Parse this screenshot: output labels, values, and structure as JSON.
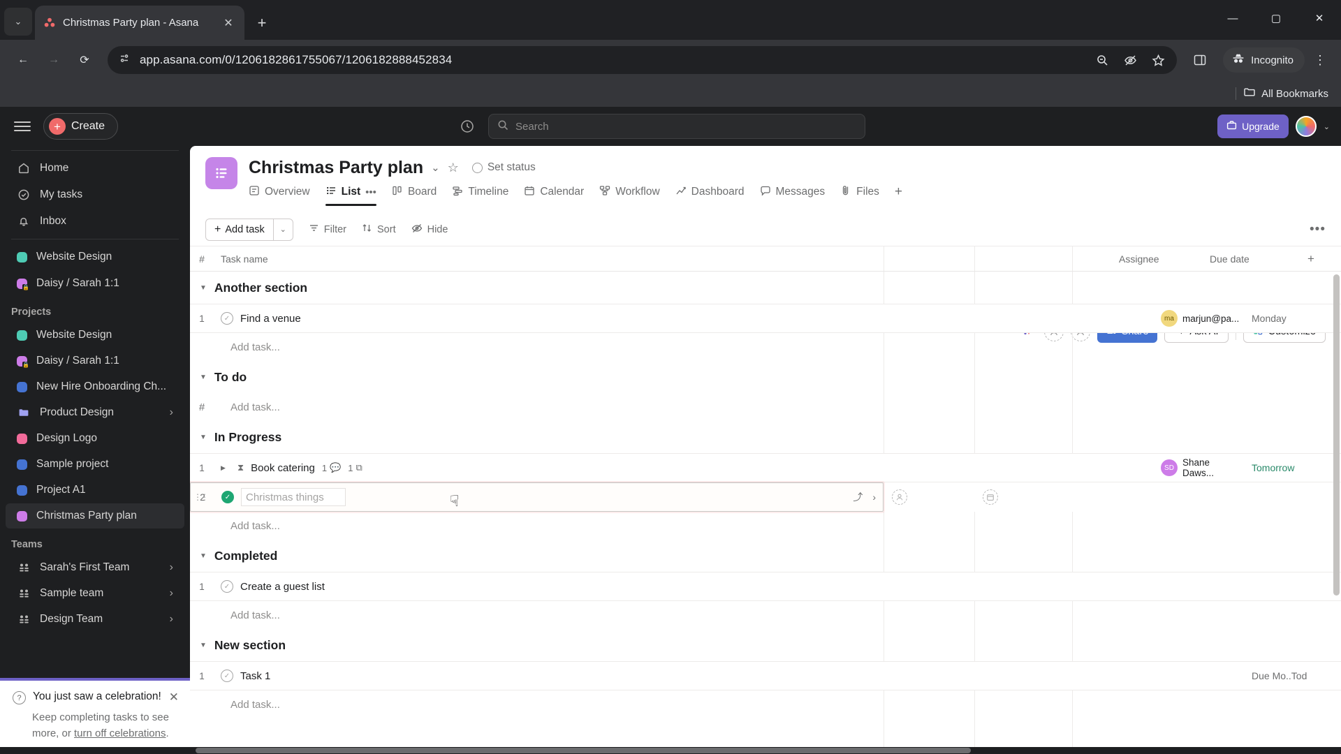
{
  "browser": {
    "tab": {
      "title": "Christmas Party plan - Asana",
      "favicon": "asana-icon",
      "close": "✕"
    },
    "tab_list_btn": "⌄",
    "new_tab": "+",
    "window_controls": {
      "minimize": "—",
      "maximize": "▢",
      "close": "✕"
    },
    "nav": {
      "back": "←",
      "forward": "→",
      "reload": "⟳"
    },
    "url": "app.asana.com/0/1206182861755067/1206182888452834",
    "site_icon": "page-info-icon",
    "omnibox_icons": [
      "zoom-out-icon",
      "eye-off-icon",
      "star-icon",
      "side-panel-icon"
    ],
    "incognito_label": "Incognito",
    "kebab": "⋮",
    "bookmarks": {
      "all_bookmarks": "All Bookmarks"
    }
  },
  "topbar": {
    "create_label": "Create",
    "search_placeholder": "Search",
    "upgrade_label": "Upgrade",
    "profile_caret": "⌄"
  },
  "sidebar": {
    "nav": [
      {
        "label": "Home",
        "icon": "home-icon"
      },
      {
        "label": "My tasks",
        "icon": "check-circle-icon"
      },
      {
        "label": "Inbox",
        "icon": "bell-icon"
      }
    ],
    "favorites": [
      {
        "label": "Website Design",
        "color": "#4ecbb4",
        "locked": false
      },
      {
        "label": "Daisy / Sarah 1:1",
        "color": "#cd7ce8",
        "locked": true
      }
    ],
    "projects_header": "Projects",
    "projects": [
      {
        "label": "Website Design",
        "color": "#4ecbb4",
        "locked": false,
        "caret": false,
        "active": false,
        "folder": false
      },
      {
        "label": "Daisy / Sarah 1:1",
        "color": "#cd7ce8",
        "locked": true,
        "caret": false,
        "active": false,
        "folder": false
      },
      {
        "label": "New Hire Onboarding Ch...",
        "color": "#4573d2",
        "locked": false,
        "caret": false,
        "active": false,
        "folder": false
      },
      {
        "label": "Product Design",
        "color": "#a0a2f2",
        "locked": false,
        "caret": true,
        "active": false,
        "folder": true
      },
      {
        "label": "Design Logo",
        "color": "#f26b9a",
        "locked": false,
        "caret": false,
        "active": false,
        "folder": false
      },
      {
        "label": "Sample project",
        "color": "#4573d2",
        "locked": false,
        "caret": false,
        "active": false,
        "folder": false
      },
      {
        "label": "Project A1",
        "color": "#4573d2",
        "locked": false,
        "caret": false,
        "active": false,
        "folder": false
      },
      {
        "label": "Christmas Party plan",
        "color": "#cd7ce8",
        "locked": false,
        "caret": false,
        "active": true,
        "folder": false
      }
    ],
    "teams_header": "Teams",
    "teams": [
      {
        "label": "Sarah's First Team",
        "caret": true
      },
      {
        "label": "Sample team",
        "caret": true
      },
      {
        "label": "Design Team",
        "caret": true
      }
    ]
  },
  "celebration": {
    "title": "You just saw a celebration!",
    "body_prefix": "Keep completing tasks to see more, or ",
    "link": "turn off celebrations",
    "body_suffix": ".",
    "close": "✕"
  },
  "project": {
    "title": "Christmas Party plan",
    "caret": "⌄",
    "star": "☆",
    "set_status": "Set status",
    "tabs": [
      {
        "label": "Overview",
        "icon": "overview-icon",
        "active": false
      },
      {
        "label": "List",
        "icon": "list-icon",
        "active": true
      },
      {
        "label": "Board",
        "icon": "board-icon",
        "active": false
      },
      {
        "label": "Timeline",
        "icon": "timeline-icon",
        "active": false
      },
      {
        "label": "Calendar",
        "icon": "calendar-icon",
        "active": false
      },
      {
        "label": "Workflow",
        "icon": "workflow-icon",
        "active": false
      },
      {
        "label": "Dashboard",
        "icon": "dashboard-icon",
        "active": false
      },
      {
        "label": "Messages",
        "icon": "messages-icon",
        "active": false
      },
      {
        "label": "Files",
        "icon": "files-icon",
        "active": false
      }
    ],
    "tab_overflow": "•••",
    "tab_add": "+",
    "header_actions": {
      "share": "Share",
      "ask_ai": "Ask AI",
      "customize": "Customize"
    }
  },
  "toolbar": {
    "add_task": "Add task",
    "add_task_caret": "⌄",
    "filter": "Filter",
    "sort": "Sort",
    "hide": "Hide",
    "more": "•••"
  },
  "table": {
    "columns": {
      "num": "#",
      "name": "Task name",
      "assignee": "Assignee",
      "due": "Due date",
      "add": "+"
    },
    "add_task_placeholder": "Add task...",
    "sections": [
      {
        "name": "Another section",
        "show_num_header": false,
        "tasks": [
          {
            "num": "1",
            "name": "Find a venue",
            "done": false,
            "assignee": "marjun@pa...",
            "assignee_initials": "ma",
            "assignee_color": "#f1d87e",
            "due": "Monday",
            "due_green": false,
            "comments": "",
            "subtasks": "",
            "has_disclosure": false,
            "editing": false
          }
        ]
      },
      {
        "name": "To do",
        "show_num_header": true,
        "tasks": []
      },
      {
        "name": "In Progress",
        "show_num_header": false,
        "tasks": [
          {
            "num": "1",
            "name": "Book catering",
            "done": false,
            "assignee": "Shane Daws...",
            "assignee_initials": "SD",
            "assignee_color": "#cd7ce8",
            "due": "Tomorrow",
            "due_green": true,
            "comments": "1",
            "subtasks": "1",
            "has_disclosure": true,
            "editing": false
          },
          {
            "num": "2",
            "name": "Christmas things",
            "done": true,
            "assignee": "",
            "assignee_initials": "",
            "assignee_color": "",
            "due": "",
            "due_green": false,
            "comments": "",
            "subtasks": "",
            "has_disclosure": false,
            "editing": true
          }
        ]
      },
      {
        "name": "Completed",
        "show_num_header": false,
        "tasks": [
          {
            "num": "1",
            "name": "Create a guest list",
            "done": false,
            "assignee": "",
            "assignee_initials": "",
            "assignee_color": "",
            "due": "",
            "due_green": false,
            "comments": "",
            "subtasks": "",
            "has_disclosure": false,
            "editing": false
          }
        ]
      },
      {
        "name": "New section",
        "show_num_header": false,
        "tasks": [
          {
            "num": "1",
            "name": "Task 1",
            "done": false,
            "assignee": "",
            "assignee_initials": "",
            "assignee_color": "",
            "due": "Due Mo..Tod",
            "due_green": false,
            "comments": "",
            "subtasks": "",
            "has_disclosure": false,
            "editing": false
          }
        ]
      }
    ]
  },
  "colors": {
    "asana_red": "#f06a6a",
    "accent_blue": "#4573d2",
    "purple": "#6e61c6",
    "green_done": "#1ea672"
  }
}
